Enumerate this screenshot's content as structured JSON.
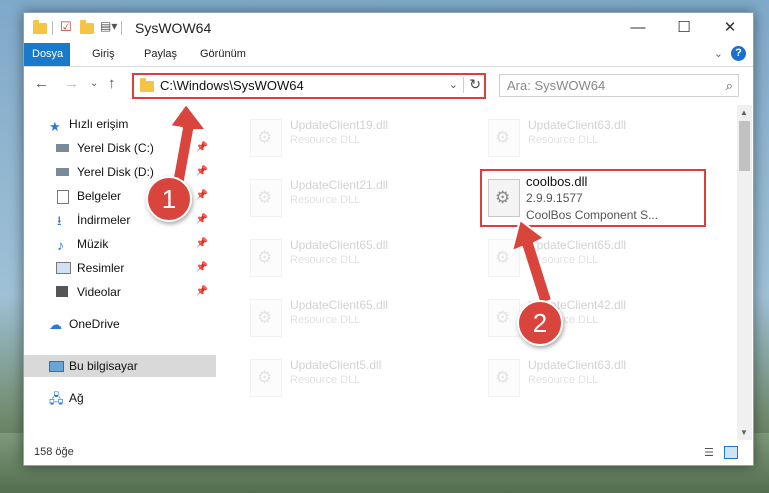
{
  "window": {
    "title": "SysWOW64"
  },
  "ribbon": {
    "tabs": [
      "Dosya",
      "Giriş",
      "Paylaş",
      "Görünüm"
    ]
  },
  "nav": {
    "address": "C:\\Windows\\SysWOW64",
    "search_placeholder": "Ara: SysWOW64"
  },
  "sidebar": {
    "items": [
      {
        "label": "Hızlı erişim",
        "icon": "star-icon"
      },
      {
        "label": "Yerel Disk (C:)",
        "icon": "drive-icon"
      },
      {
        "label": "Yerel Disk (D:)",
        "icon": "drive-icon"
      },
      {
        "label": "Belgeler",
        "icon": "documents-icon"
      },
      {
        "label": "İndirmeler",
        "icon": "downloads-icon"
      },
      {
        "label": "Müzik",
        "icon": "music-icon"
      },
      {
        "label": "Resimler",
        "icon": "pictures-icon"
      },
      {
        "label": "Videolar",
        "icon": "video-icon"
      },
      {
        "label": "OneDrive",
        "icon": "cloud-icon"
      },
      {
        "label": "Bu bilgisayar",
        "icon": "computer-icon"
      },
      {
        "label": "Ağ",
        "icon": "network-icon"
      }
    ]
  },
  "files": [
    {
      "name": "UpdateClient19.dll",
      "desc": "Resource DLL"
    },
    {
      "name": "UpdateClient63.dll",
      "desc": "Resource DLL"
    },
    {
      "name": "UpdateClient21.dll",
      "desc": "Resource DLL"
    },
    {
      "name": "coolbos.dll",
      "version": "2.9.9.1577",
      "desc": "CoolBos Component S..."
    },
    {
      "name": "UpdateClient65.dll",
      "desc": "Resource DLL"
    },
    {
      "name": "UpdateClient65.dll",
      "desc": "Resource DLL"
    },
    {
      "name": "UpdateClient65.dll",
      "desc": "Resource DLL"
    },
    {
      "name": "UpdateClient42.dll",
      "desc": "Resource DLL"
    },
    {
      "name": "UpdateClient5.dll",
      "desc": "Resource DLL"
    },
    {
      "name": "UpdateClient63.dll",
      "desc": "Resource DLL"
    }
  ],
  "status": {
    "count": "158 öğe"
  },
  "callouts": [
    "1",
    "2"
  ],
  "colors": {
    "accent": "#1979ca",
    "highlight": "#d9403a"
  }
}
